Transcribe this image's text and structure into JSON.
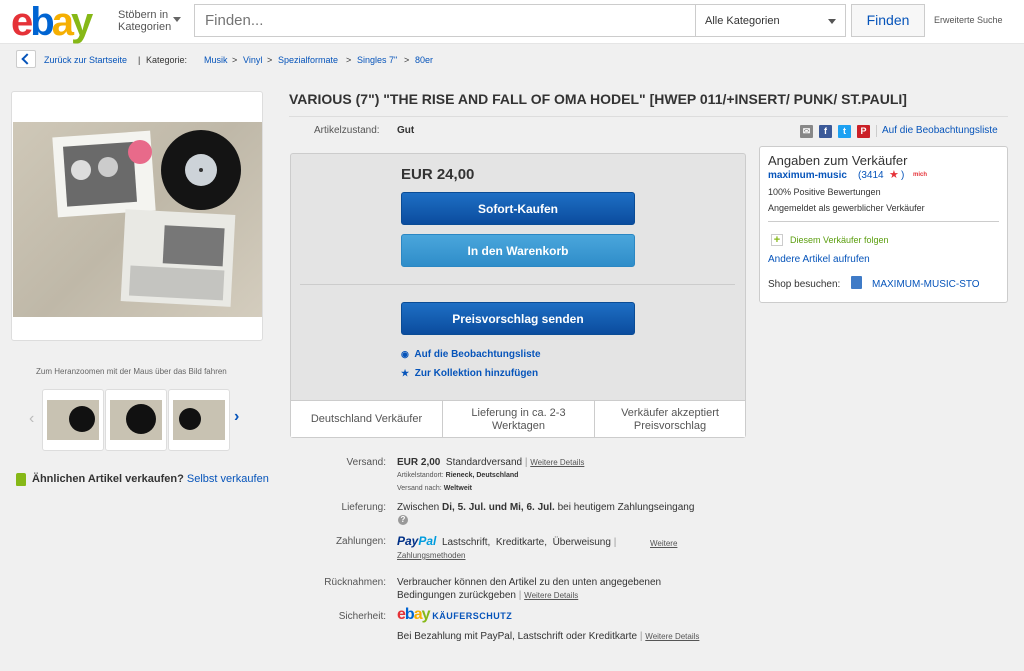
{
  "header": {
    "logo": [
      "e",
      "b",
      "a",
      "y"
    ],
    "browse_line1": "Stöbern in",
    "browse_line2": "Kategorien",
    "search_placeholder": "Finden...",
    "category": "Alle Kategorien",
    "find_button": "Finden",
    "advanced": "Erweiterte Suche"
  },
  "breadcrumb": {
    "back": "Zurück zur Startseite",
    "separator": "|",
    "category_label": "Kategorie:",
    "items": [
      "Musik",
      "Vinyl",
      "Spezialformate",
      "Singles 7\"",
      "80er"
    ],
    "arrow": ">"
  },
  "gallery": {
    "zoom_hint": "Zum Heranzoomen mit der Maus über das Bild fahren",
    "thumb_count": 3
  },
  "sell_similar": {
    "question": "Ähnlichen Artikel verkaufen?",
    "link": "Selbst verkaufen"
  },
  "item": {
    "title": "VARIOUS (7\") \"THE RISE AND FALL OF OMA HODEL\" [HWEP 011/+INSERT/ PUNK/ ST.PAULI]",
    "condition_label": "Artikelzustand:",
    "condition_value": "Gut",
    "watch_link": "Auf die Beobachtungsliste",
    "share_icons": [
      "mail-icon",
      "facebook-icon",
      "twitter-icon",
      "pinterest-icon"
    ]
  },
  "buybox": {
    "price": "EUR 24,00",
    "buy_now": "Sofort-Kaufen",
    "add_to_cart": "In den Warenkorb",
    "make_offer": "Preisvorschlag senden",
    "watch": "Auf die Beobachtungsliste",
    "collection": "Zur Kollektion hinzufügen",
    "features": [
      "Deutschland Verkäufer",
      "Lieferung in ca. 2-3 Werktagen",
      "Verkäufer akzeptiert Preisvorschlag"
    ]
  },
  "details": {
    "shipping_label": "Versand:",
    "shipping_price": "EUR 2,00",
    "shipping_method": "Standardversand",
    "more": "Weitere Details",
    "location_label": "Artikelstandort:",
    "location_value": "Rieneck, Deutschland",
    "ships_to_label": "Versand nach:",
    "ships_to_value": "Weltweit",
    "delivery_label": "Lieferung:",
    "delivery_prefix": "Zwischen",
    "delivery_dates": "Di, 5. Jul. und Mi, 6. Jul.",
    "delivery_suffix": "bei heutigem Zahlungseingang",
    "payment_label": "Zahlungen:",
    "paypal_a": "Pay",
    "paypal_b": "Pal",
    "payment_methods": [
      "Lastschrift,",
      "Kreditkarte,",
      "Überweisung"
    ],
    "payment_more": "Weitere Zahlungsmethoden",
    "returns_label": "Rücknahmen:",
    "returns_line1": "Verbraucher können den Artikel zu den unten angegebenen",
    "returns_line2": "Bedingungen zurückgeben",
    "security_label": "Sicherheit:",
    "protection": "KÄUFERSCHUTZ",
    "security_text": "Bei Bezahlung mit PayPal, Lastschrift oder Kreditkarte"
  },
  "seller": {
    "title": "Angaben zum Verkäufer",
    "name": "maximum-music",
    "score": "(3414",
    "badge": "mich",
    "positive": "100% Positive Bewertungen",
    "registered": "Angemeldet als gewerblicher Verkäufer",
    "follow": "Diesem Verkäufer folgen",
    "other_items": "Andere Artikel aufrufen",
    "shop_label": "Shop besuchen:",
    "shop_name": "MAXIMUM-MUSIC-STO"
  }
}
